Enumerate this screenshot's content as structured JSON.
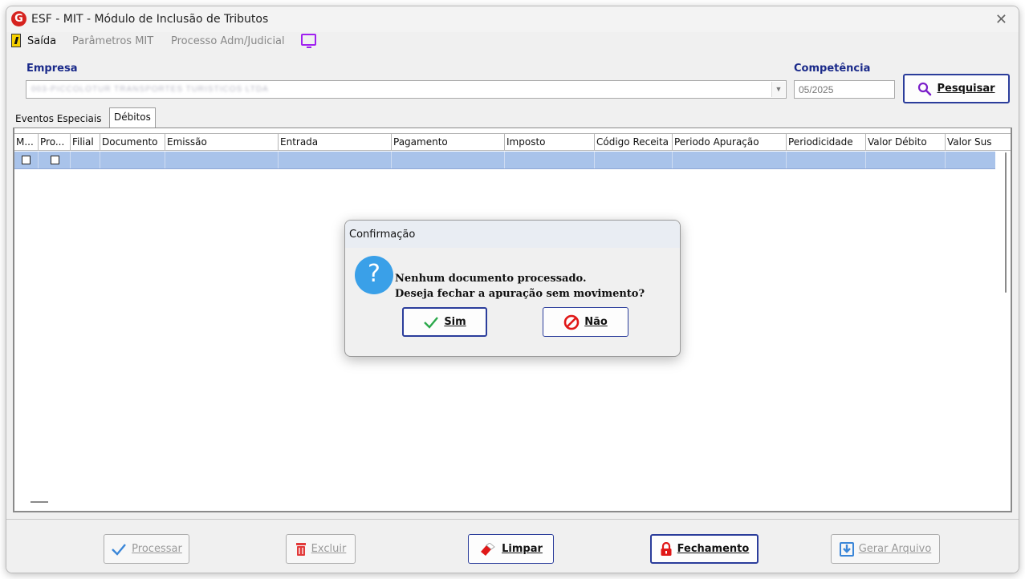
{
  "window": {
    "title": "ESF - MIT - Módulo de Inclusão de Tributos",
    "close_glyph": "✕",
    "app_icon_glyph": "G",
    "app_icon_color": "#d6231f"
  },
  "menu": {
    "items": [
      {
        "label": "Saída",
        "enabled": true
      },
      {
        "label": "Parâmetros MIT",
        "enabled": false
      },
      {
        "label": "Processo Adm/Judicial",
        "enabled": false
      }
    ],
    "monitor_icon": "monitor-icon"
  },
  "form": {
    "empresa_label": "Empresa",
    "empresa_value": "003-PICCOLOTUR TRANSPORTES TURISTICOS LTDA",
    "competencia_label": "Competência",
    "competencia_value": "05/2025",
    "search_button": "Pesquisar"
  },
  "tabs": [
    {
      "label": "Eventos Especiais",
      "selected": false
    },
    {
      "label": "Débitos",
      "selected": true
    }
  ],
  "grid": {
    "columns": [
      "M...",
      "Pro...",
      "Filial",
      "Documento",
      "Emissão",
      "Entrada",
      "Pagamento",
      "Imposto",
      "Código Receita",
      "Periodo Apuração",
      "Periodicidade",
      "Valor Débito",
      "Valor Sus"
    ],
    "rows": [
      {
        "marcar": false,
        "processar": false
      }
    ],
    "selected_row_color": "#a9c3ea"
  },
  "dialog": {
    "title": "Confirmação",
    "line1": "Nenhum documento processado.",
    "line2": "Deseja fechar a apuração sem movimento?",
    "yes_label": "Sim",
    "no_label": "Não",
    "icon": "question-icon"
  },
  "actions": {
    "processar": "Processar",
    "excluir": "Excluir",
    "limpar": "Limpar",
    "fechamento": "Fechamento",
    "gerar_arquivo": "Gerar Arquivo"
  },
  "colors": {
    "label_blue": "#1a2a8a",
    "primary_border": "#2b3d9b",
    "question_blue": "#3aa0e8"
  }
}
